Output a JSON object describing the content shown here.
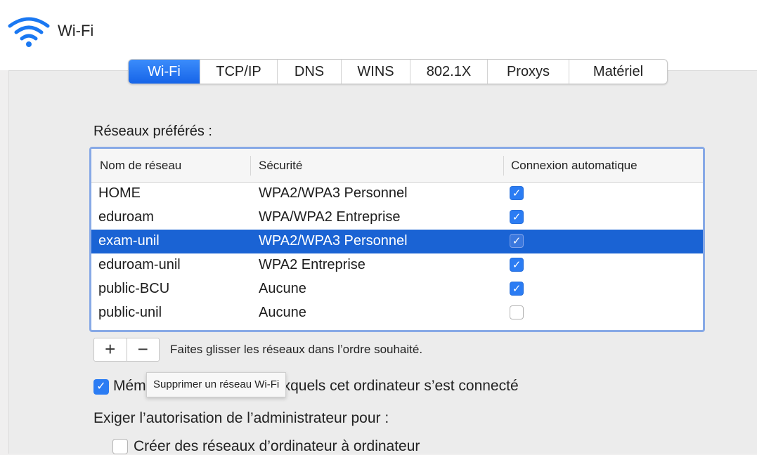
{
  "header": {
    "title": "Wi-Fi",
    "icon": "wifi-icon"
  },
  "tabs": [
    {
      "label": "Wi-Fi",
      "active": true
    },
    {
      "label": "TCP/IP",
      "active": false
    },
    {
      "label": "DNS",
      "active": false
    },
    {
      "label": "WINS",
      "active": false
    },
    {
      "label": "802.1X",
      "active": false
    },
    {
      "label": "Proxys",
      "active": false
    },
    {
      "label": "Matériel",
      "active": false
    }
  ],
  "networks": {
    "label": "Réseaux préférés :",
    "columns": [
      "Nom de réseau",
      "Sécurité",
      "Connexion automatique"
    ],
    "rows": [
      {
        "name": "HOME",
        "security": "WPA2/WPA3 Personnel",
        "auto": true,
        "selected": false
      },
      {
        "name": "eduroam",
        "security": "WPA/WPA2 Entreprise",
        "auto": true,
        "selected": false
      },
      {
        "name": "exam-unil",
        "security": "WPA2/WPA3 Personnel",
        "auto": true,
        "selected": true
      },
      {
        "name": "eduroam-unil",
        "security": "WPA2 Entreprise",
        "auto": true,
        "selected": false
      },
      {
        "name": "public-BCU",
        "security": "Aucune",
        "auto": true,
        "selected": false
      },
      {
        "name": "public-unil",
        "security": "Aucune",
        "auto": false,
        "selected": false
      }
    ]
  },
  "controls": {
    "add_label": "+",
    "remove_label": "−",
    "hint": "Faites glisser les réseaux dans l’ordre souhaité.",
    "tooltip": "Supprimer un réseau Wi-Fi"
  },
  "options": {
    "remember_label": "Mémoriser les réseaux auxquels cet ordinateur s’est connecté",
    "remember_checked": true,
    "admin_label": "Exiger l’autorisation de l’administrateur pour :",
    "p2p_label": "Créer des réseaux d’ordinateur à ordinateur",
    "p2p_checked": false
  },
  "colors": {
    "accent": "#1b6df0",
    "selection": "#1a63d4",
    "focus_ring": "#87a9e6"
  }
}
